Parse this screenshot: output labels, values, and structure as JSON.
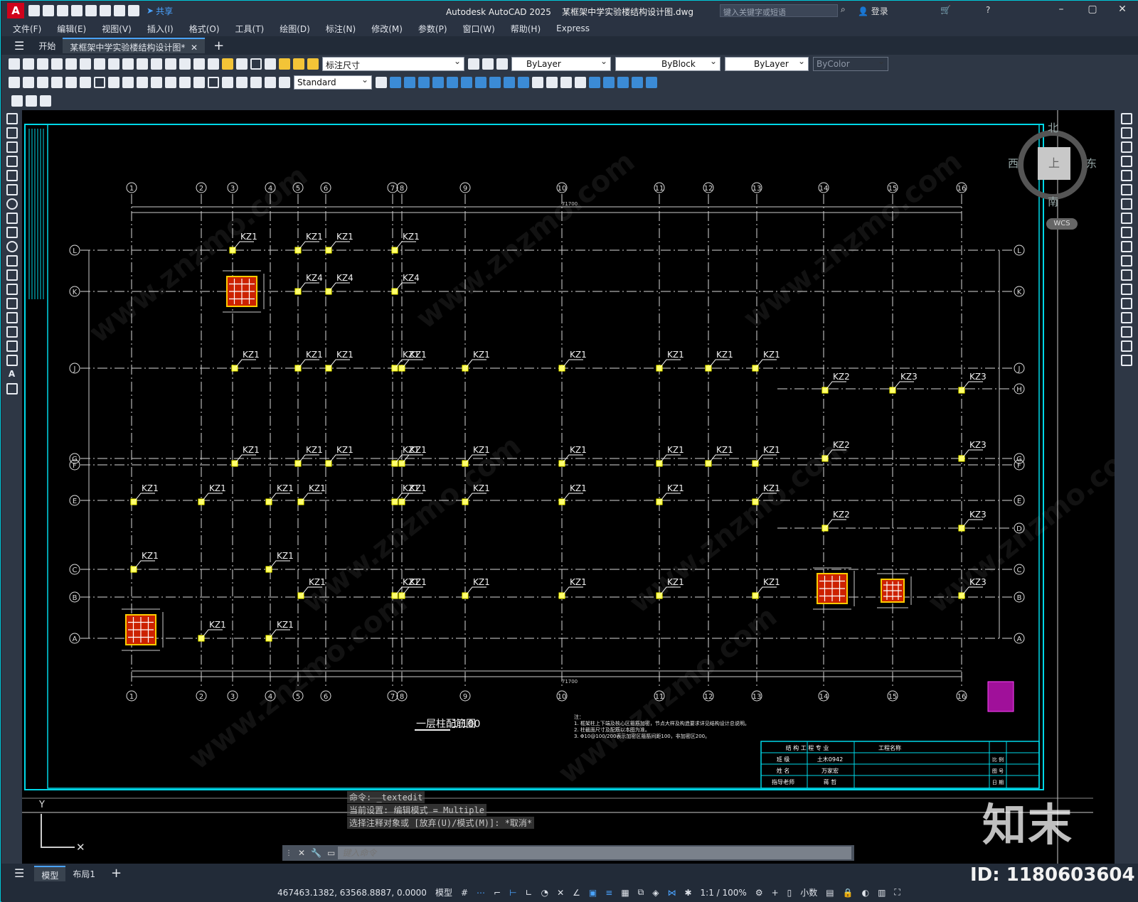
{
  "app": {
    "title": "Autodesk AutoCAD 2025",
    "document": "某框架中学实验楼结构设计图.dwg",
    "share": "共享",
    "search_placeholder": "键入关键字或短语",
    "login": "登录"
  },
  "menu": [
    "文件(F)",
    "编辑(E)",
    "视图(V)",
    "插入(I)",
    "格式(O)",
    "工具(T)",
    "绘图(D)",
    "标注(N)",
    "修改(M)",
    "参数(P)",
    "窗口(W)",
    "帮助(H)",
    "Express"
  ],
  "tabs": {
    "start": "开始",
    "active": "某框架中学实验楼结构设计图*"
  },
  "toolbar": {
    "layer": "标注尺寸",
    "color": "ByLayer",
    "linetype": "ByBlock",
    "lineweight": "ByLayer",
    "plotstyle": "ByColor",
    "textstyle": "Standard"
  },
  "viewcube": {
    "north": "北",
    "south": "南",
    "east": "东",
    "west": "西",
    "face": "上",
    "wcs": "WCS"
  },
  "drawing": {
    "grid_cols": [
      "1",
      "2",
      "3",
      "4",
      "5",
      "6",
      "7",
      "8",
      "9",
      "10",
      "11",
      "12",
      "13",
      "14",
      "15",
      "16"
    ],
    "grid_rows": [
      "L",
      "K",
      "J",
      "H",
      "G",
      "F",
      "E",
      "D",
      "C",
      "B",
      "A"
    ],
    "column_labels": {
      "kz1": "KZ1",
      "kz2": "KZ2",
      "kz3": "KZ3",
      "kz4": "KZ4"
    },
    "total_dim": "71700",
    "plan_title": "一层柱配筋图",
    "plan_scale": "1:100",
    "notes": [
      "注：",
      "1. 框架柱上下端及核心区箍筋加密，节点大样及构造要求详见结构设计总说明。",
      "2. 柱截面尺寸及配筋以本图为准。",
      "3. Φ10@100/200表示加密区箍筋间距100，非加密区200。"
    ],
    "titleblock": {
      "h1": "结 构 工 程 专 业",
      "h2": "工程名称",
      "r1a": "班 级",
      "r1b": "土木0942",
      "r2a": "姓 名",
      "r2b": "万家宏",
      "r3a": "指导老师",
      "r3b": "蒋 哲",
      "c1": "图 号",
      "c2": "日 期",
      "c3": "比 例"
    }
  },
  "command": {
    "history": [
      "命令: _textedit",
      "当前设置: 编辑模式 = Multiple",
      "选择注释对象或 [放弃(U)/模式(M)]: *取消*"
    ],
    "placeholder": "键入命令"
  },
  "layouts": [
    "模型",
    "布局1"
  ],
  "status": {
    "coords": "467463.1382, 63568.8887, 0.0000",
    "model": "模型",
    "scale": "1:1 / 100%",
    "units": "小数"
  },
  "watermark": {
    "brand": "知末",
    "id": "ID: 1180603604",
    "url": "www.znzmo.com"
  }
}
